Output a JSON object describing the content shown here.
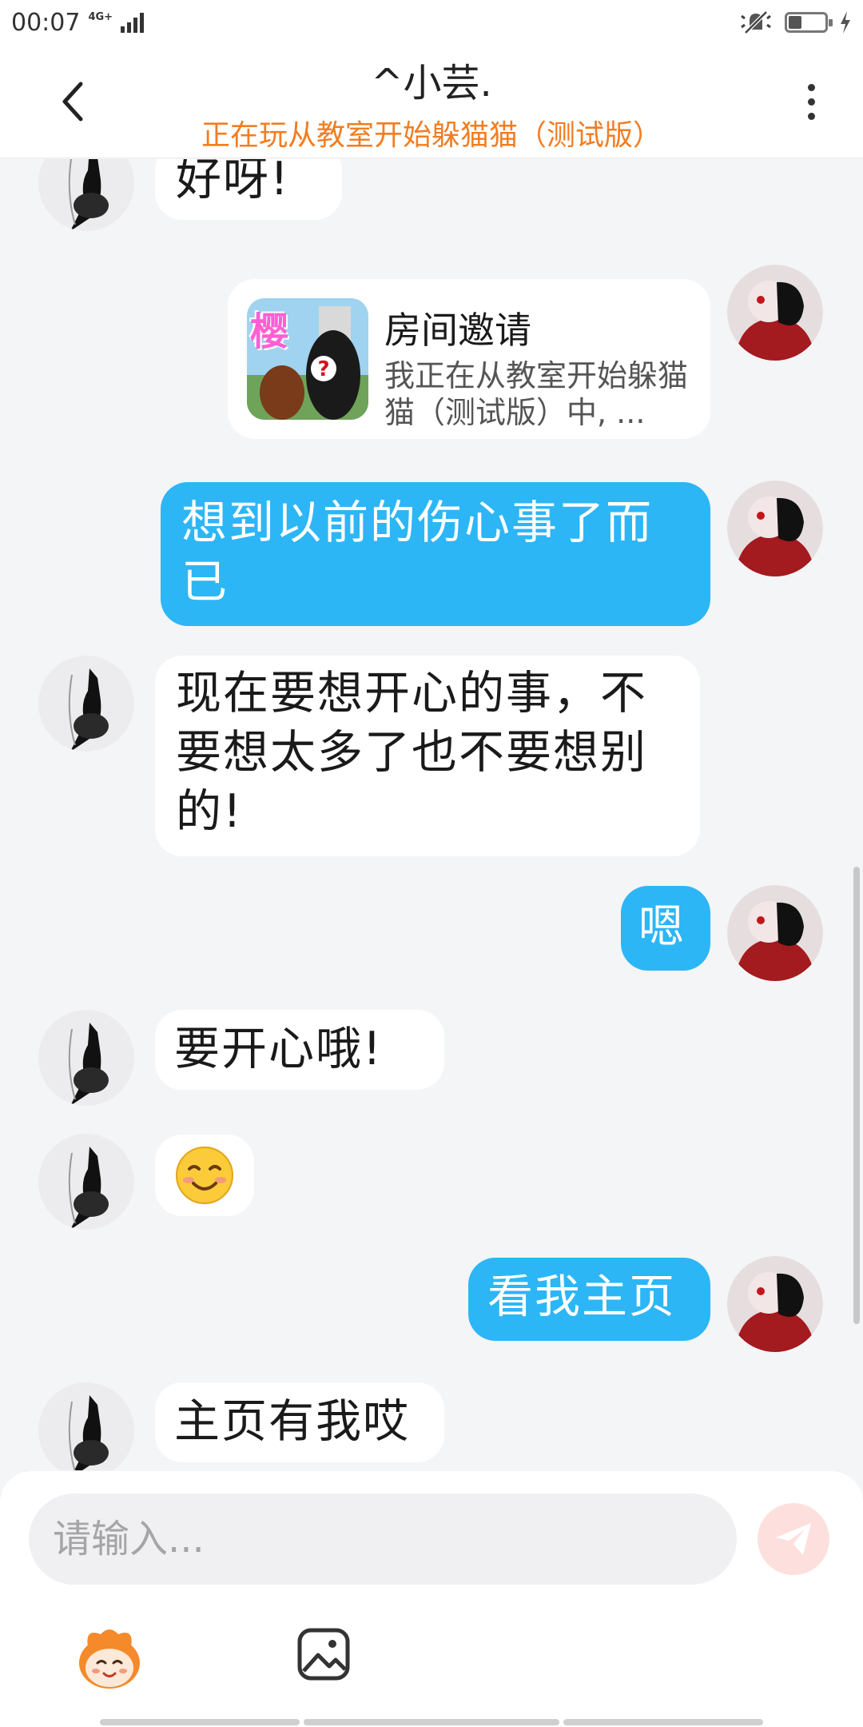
{
  "status_bar": {
    "time": "00:07",
    "network": "4G+"
  },
  "header": {
    "back_icon": "chevron-left-icon",
    "title": "^小芸.",
    "subtitle": "正在玩从教室开始躲猫猫（测试版）",
    "more_icon": "more-vertical-icon"
  },
  "messages": [
    {
      "side": "in",
      "type": "text",
      "text": "好呀!"
    },
    {
      "side": "out",
      "type": "invite",
      "title": "房间邀请",
      "desc": "我正在从教室开始躲猫猫（测试版）中, ...",
      "thumb_label": "樱"
    },
    {
      "side": "out",
      "type": "text",
      "text": "想到以前的伤心事了而已"
    },
    {
      "side": "in",
      "type": "text",
      "text": "现在要想开心的事，不要想太多了也不要想别的!"
    },
    {
      "side": "out",
      "type": "text",
      "text": "嗯"
    },
    {
      "side": "in",
      "type": "text",
      "text": "要开心哦!"
    },
    {
      "side": "in",
      "type": "emoji",
      "text": "😊"
    },
    {
      "side": "out",
      "type": "text",
      "text": "看我主页"
    },
    {
      "side": "in",
      "type": "text",
      "text": "主页有我哎"
    }
  ],
  "input": {
    "placeholder": "请输入..."
  },
  "toolbar": {
    "icons": [
      "mascot-icon",
      "image-icon",
      "send-icon"
    ]
  }
}
